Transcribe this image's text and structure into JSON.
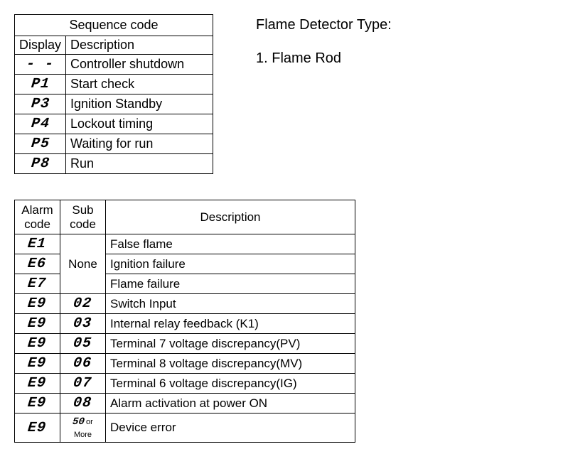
{
  "sequence": {
    "title": "Sequence code",
    "headers": {
      "display": "Display",
      "description": "Description"
    },
    "rows": [
      {
        "display": "- -",
        "description": "Controller shutdown"
      },
      {
        "display": "P1",
        "description": "Start check"
      },
      {
        "display": "P3",
        "description": "Ignition Standby"
      },
      {
        "display": "P4",
        "description": "Lockout timing"
      },
      {
        "display": "P5",
        "description": "Waiting for run"
      },
      {
        "display": "P8",
        "description": "Run"
      }
    ]
  },
  "detector": {
    "heading": "Flame Detector Type:",
    "item1": "1. Flame Rod"
  },
  "alarm": {
    "headers": {
      "alarm": "Alarm code",
      "sub": "Sub code",
      "description": "Description"
    },
    "none_label": "None",
    "rows": [
      {
        "alarm": "E1",
        "sub": "",
        "description": "False flame"
      },
      {
        "alarm": "E6",
        "sub": "",
        "description": "Ignition failure"
      },
      {
        "alarm": "E7",
        "sub": "",
        "description": "Flame failure"
      },
      {
        "alarm": "E9",
        "sub": "02",
        "description": "Switch Input"
      },
      {
        "alarm": "E9",
        "sub": "03",
        "description": "Internal relay feedback (K1)"
      },
      {
        "alarm": "E9",
        "sub": "05",
        "description": "Terminal 7 voltage discrepancy(PV)"
      },
      {
        "alarm": "E9",
        "sub": "06",
        "description": "Terminal 8 voltage discrepancy(MV)"
      },
      {
        "alarm": "E9",
        "sub": "07",
        "description": "Terminal 6 voltage discrepancy(IG)"
      },
      {
        "alarm": "E9",
        "sub": "08",
        "description": "Alarm activation at power ON"
      },
      {
        "alarm": "E9",
        "sub": "50",
        "sub_suffix": "or More",
        "description": "Device error"
      }
    ]
  }
}
